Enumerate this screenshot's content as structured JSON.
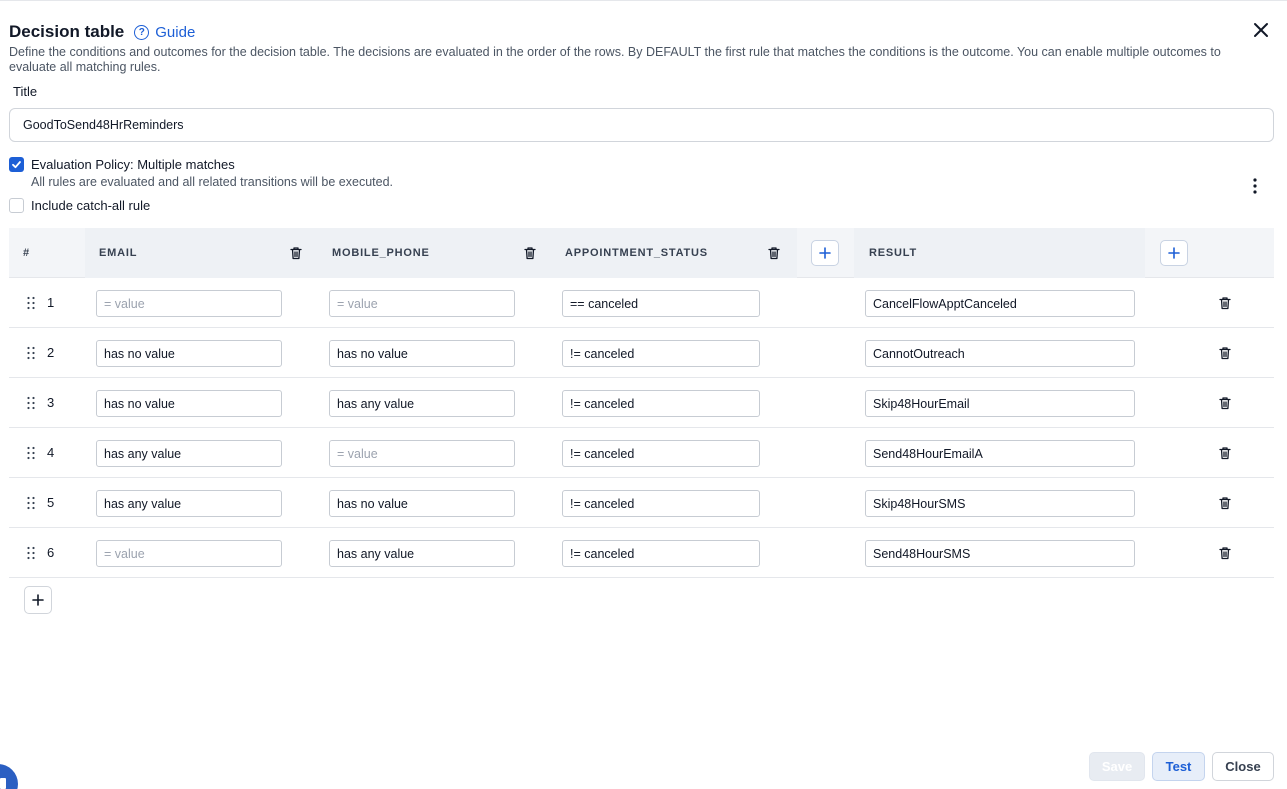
{
  "dialog": {
    "title": "Decision table",
    "guide_label": "Guide",
    "description": "Define the conditions and outcomes for the decision table. The decisions are evaluated in the order of the rows. By DEFAULT the first rule that matches the conditions is the outcome. You can enable multiple outcomes to evaluate all matching rules.",
    "title_label": "Title",
    "title_value": "GoodToSend48HrReminders",
    "policy": {
      "label": "Evaluation Policy: Multiple matches",
      "sublabel": "All rules are evaluated and all related transitions will be executed.",
      "checked": true
    },
    "catch_all": {
      "label": "Include catch-all rule",
      "checked": false
    }
  },
  "table": {
    "columns": {
      "num": "#",
      "email": "EMAIL",
      "mobile": "MOBILE_PHONE",
      "status": "APPOINTMENT_STATUS",
      "result": "RESULT"
    },
    "rows": [
      {
        "num": "1",
        "email": "",
        "mobile": "",
        "status": "== canceled",
        "result": "CancelFlowApptCanceled"
      },
      {
        "num": "2",
        "email": "has no value",
        "mobile": "has no value",
        "status": "!= canceled",
        "result": "CannotOutreach"
      },
      {
        "num": "3",
        "email": "has no value",
        "mobile": "has any value",
        "status": "!= canceled",
        "result": "Skip48HourEmail"
      },
      {
        "num": "4",
        "email": "has any value",
        "mobile": "",
        "status": "!= canceled",
        "result": "Send48HourEmailA"
      },
      {
        "num": "5",
        "email": "has any value",
        "mobile": "has no value",
        "status": "!= canceled",
        "result": "Skip48HourSMS"
      },
      {
        "num": "6",
        "email": "",
        "mobile": "has any value",
        "status": "!= canceled",
        "result": "Send48HourSMS"
      }
    ],
    "placeholder": "= value"
  },
  "footer": {
    "save": "Save",
    "test": "Test",
    "close": "Close"
  },
  "colors": {
    "accent": "#1d5fd6",
    "header_bg": "#f3f5f8"
  },
  "icons": [
    "help-circle-icon",
    "close-icon",
    "check-icon",
    "kebab-menu-icon",
    "trash-icon",
    "plus-icon",
    "drag-handle-icon"
  ]
}
